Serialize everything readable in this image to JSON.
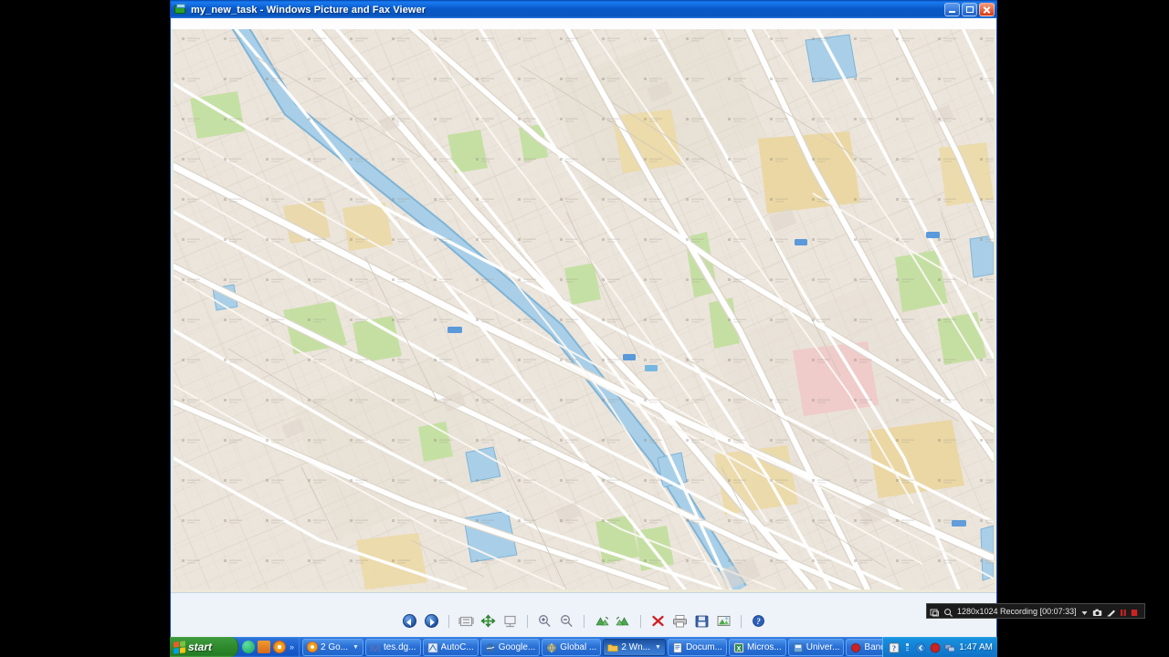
{
  "window": {
    "title": "my_new_task - Windows Picture and Fax Viewer",
    "icon": "picture-fax-viewer-icon",
    "controls": {
      "minimize": "Minimize",
      "restore": "Restore Down",
      "close": "Close"
    }
  },
  "toolbar": {
    "buttons": [
      {
        "name": "previous-image-button",
        "label": "Previous Image",
        "icon": "circle-left-arrow-icon"
      },
      {
        "name": "next-image-button",
        "label": "Next Image",
        "icon": "circle-right-arrow-icon"
      },
      {
        "name": "best-fit-button",
        "label": "Best Fit",
        "icon": "best-fit-icon"
      },
      {
        "name": "actual-size-button",
        "label": "Actual Size",
        "icon": "actual-size-icon"
      },
      {
        "name": "start-slideshow-button",
        "label": "Start Slide Show",
        "icon": "slideshow-icon"
      },
      {
        "name": "zoom-in-button",
        "label": "Zoom In",
        "icon": "magnifier-plus-icon"
      },
      {
        "name": "zoom-out-button",
        "label": "Zoom Out",
        "icon": "magnifier-minus-icon"
      },
      {
        "name": "rotate-clockwise-button",
        "label": "Rotate Clockwise",
        "icon": "rotate-cw-icon"
      },
      {
        "name": "rotate-counterclockwise-button",
        "label": "Rotate Counter Clockwise",
        "icon": "rotate-ccw-icon"
      },
      {
        "name": "delete-button",
        "label": "Delete",
        "icon": "red-x-icon"
      },
      {
        "name": "print-button",
        "label": "Print",
        "icon": "printer-icon"
      },
      {
        "name": "copy-to-button",
        "label": "Copy To",
        "icon": "floppy-save-icon"
      },
      {
        "name": "edit-button",
        "label": "Edit Picture",
        "icon": "edit-picture-icon"
      },
      {
        "name": "help-button",
        "label": "Help",
        "icon": "blue-help-icon"
      }
    ]
  },
  "bandicam": {
    "resolution": "1280x1024",
    "status": "Recording",
    "elapsed": "[00:07:33]",
    "status_text": "1280x1024 Recording [00:07:33]",
    "icons": [
      "target-window-icon",
      "magnifier-icon",
      "dropdown-arrow-icon",
      "camera-icon",
      "pen-icon",
      "pause-icon",
      "stop-icon"
    ],
    "accent": "#cc2222"
  },
  "map": {
    "type": "street-map",
    "colors": {
      "land": "#ece5dc",
      "land_alt": "#e6ded2",
      "water": "#a9cfe8",
      "water_edge": "#7fb4d6",
      "road_major": "#ffffff",
      "road_minor": "#f7f4ef",
      "road_casing": "#d9d2c6",
      "park": "#c3dfa0",
      "commercial": "#ecd9a3",
      "medical": "#efc9c9",
      "building": "#dcd4c8"
    }
  },
  "taskbar": {
    "start_label": "start",
    "quick_launch": [
      {
        "name": "quicklaunch-icon-1",
        "icon": "green-circle-icon",
        "color": "#2db36b"
      },
      {
        "name": "quicklaunch-icon-2",
        "icon": "orange-g-icon",
        "color": "#e8801a"
      },
      {
        "name": "quicklaunch-icon-3",
        "icon": "chrome-icon",
        "color": "#f0a01c"
      },
      {
        "name": "quicklaunch-overflow",
        "icon": "double-chevron-icon",
        "label": "»"
      }
    ],
    "tasks": [
      {
        "name": "taskbar-item-google-chrome-group",
        "label": "2 Go...",
        "icon": "chrome-icon",
        "color": "#f0a01c",
        "group": true,
        "active": false
      },
      {
        "name": "taskbar-item-tes-dgn",
        "label": "tes.dg...",
        "icon": "microstation-icon",
        "color": "#5a6fb5",
        "group": false,
        "active": false
      },
      {
        "name": "taskbar-item-autocad",
        "label": "AutoC...",
        "icon": "autocad-icon",
        "color": "#2f6fb5",
        "group": false,
        "active": false
      },
      {
        "name": "taskbar-item-google-earth",
        "label": "Google...",
        "icon": "google-earth-icon",
        "color": "#3a6ea8",
        "group": false,
        "active": false
      },
      {
        "name": "taskbar-item-global-mapper",
        "label": "Global ...",
        "icon": "globe-icon",
        "color": "#8a8f6a",
        "group": false,
        "active": false
      },
      {
        "name": "taskbar-item-windows-explorer-group",
        "label": "2 Wn...",
        "icon": "folder-icon",
        "color": "#f3c24b",
        "group": true,
        "active": true
      },
      {
        "name": "taskbar-item-document",
        "label": "Docum...",
        "icon": "word-document-icon",
        "color": "#3a6ea8",
        "group": false,
        "active": false
      },
      {
        "name": "taskbar-item-microsoft-excel",
        "label": "Micros...",
        "icon": "excel-icon",
        "color": "#2e8b57",
        "group": false,
        "active": false
      },
      {
        "name": "taskbar-item-universal",
        "label": "Univer...",
        "icon": "app-icon",
        "color": "#6fa8d8",
        "group": false,
        "active": false
      },
      {
        "name": "taskbar-item-bandicam",
        "label": "Bandicam",
        "icon": "record-dot-icon",
        "color": "#cc2222",
        "group": false,
        "active": false
      }
    ],
    "tray": [
      {
        "name": "tray-icon-help",
        "icon": "question-mark-icon"
      },
      {
        "name": "tray-icon-small",
        "icon": "small-app-icon"
      },
      {
        "name": "tray-show-hidden",
        "icon": "chevron-left-icon"
      },
      {
        "name": "tray-icon-bandicam",
        "icon": "record-dot-icon"
      },
      {
        "name": "tray-icon-network",
        "icon": "network-icon"
      }
    ],
    "clock": "1:47 AM"
  }
}
